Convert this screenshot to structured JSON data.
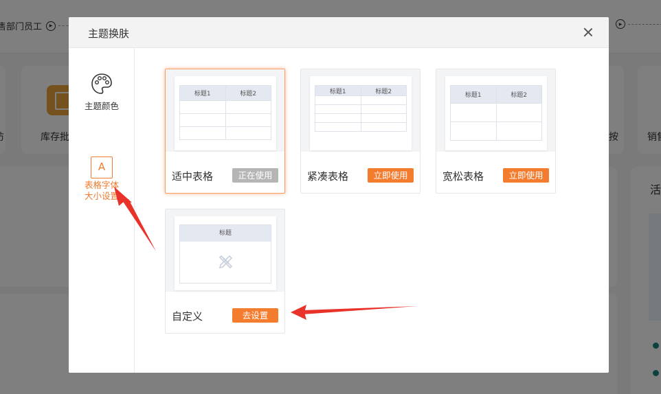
{
  "background": {
    "flow_step_left": "售部门员工",
    "tile_label_1": "库存批",
    "tile_label_left": "访",
    "tile_label_right_1": "按",
    "tile_label_right_2": "销售",
    "panel_title_right": "活"
  },
  "modal": {
    "title": "主题换肤",
    "close_icon": "close-icon",
    "sidebar": [
      {
        "label_line1": "主题颜色",
        "label_line2": "",
        "icon": "palette-icon",
        "active": false
      },
      {
        "label_line1": "表格字体",
        "label_line2": "大小设置",
        "icon": "font-size-icon",
        "icon_text": "A",
        "active": true
      }
    ],
    "accent_color": "#f47c2f",
    "themes": [
      {
        "name": "适中表格",
        "button": "正在使用",
        "status": "in-use",
        "header_cells": [
          "标题1",
          "标题2"
        ],
        "rows": 3
      },
      {
        "name": "紧凑表格",
        "button": "立即使用",
        "status": "apply",
        "header_cells": [
          "标题1",
          "标题2"
        ],
        "rows": 4
      },
      {
        "name": "宽松表格",
        "button": "立即使用",
        "status": "apply",
        "header_cells": [
          "标题1",
          "标题2"
        ],
        "rows": 2
      }
    ],
    "custom": {
      "name": "自定义",
      "button": "去设置",
      "header_text": "标题",
      "icon": "pencil-ruler-icon"
    }
  }
}
